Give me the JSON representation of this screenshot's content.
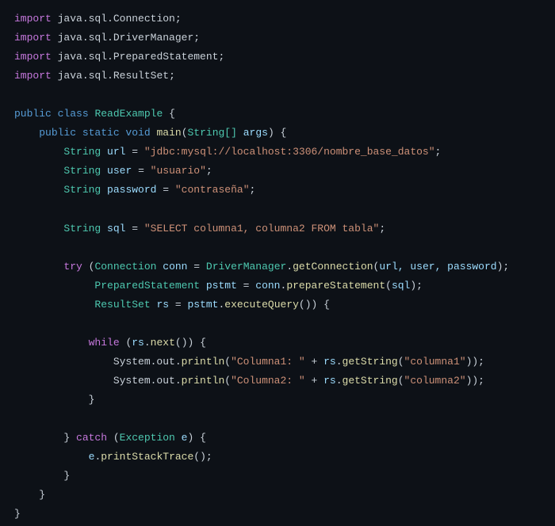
{
  "imports": [
    {
      "package": "java.sql.Connection"
    },
    {
      "package": "java.sql.DriverManager"
    },
    {
      "package": "java.sql.PreparedStatement"
    },
    {
      "package": "java.sql.ResultSet"
    }
  ],
  "class_declaration": {
    "modifiers": "public class",
    "name": "ReadExample"
  },
  "main_method": {
    "modifiers": "public static void",
    "name": "main",
    "param_type": "String[]",
    "param_name": "args"
  },
  "variables": {
    "url": {
      "type": "String",
      "name": "url",
      "value": "\"jdbc:mysql://localhost:3306/nombre_base_datos\""
    },
    "user": {
      "type": "String",
      "name": "user",
      "value": "\"usuario\""
    },
    "password": {
      "type": "String",
      "name": "password",
      "value": "\"contraseña\""
    },
    "sql": {
      "type": "String",
      "name": "sql",
      "value": "\"SELECT columna1, columna2 FROM tabla\""
    }
  },
  "try_resources": {
    "conn": {
      "type": "Connection",
      "name": "conn",
      "expr_class": "DriverManager",
      "expr_method": "getConnection",
      "args": "url, user, password"
    },
    "pstmt": {
      "type": "PreparedStatement",
      "name": "pstmt",
      "expr_obj": "conn",
      "expr_method": "prepareStatement",
      "args": "sql"
    },
    "rs": {
      "type": "ResultSet",
      "name": "rs",
      "expr_obj": "pstmt",
      "expr_method": "executeQuery",
      "args": ""
    }
  },
  "while_loop": {
    "condition_obj": "rs",
    "condition_method": "next",
    "prints": [
      {
        "label": "\"Columna1: \"",
        "call_obj": "rs",
        "call_method": "getString",
        "call_arg": "\"columna1\""
      },
      {
        "label": "\"Columna2: \"",
        "call_obj": "rs",
        "call_method": "getString",
        "call_arg": "\"columna2\""
      }
    ]
  },
  "catch_block": {
    "exception_type": "Exception",
    "exception_var": "e",
    "body_obj": "e",
    "body_method": "printStackTrace"
  },
  "keywords": {
    "import": "import",
    "try": "try",
    "while": "while",
    "catch": "catch"
  }
}
